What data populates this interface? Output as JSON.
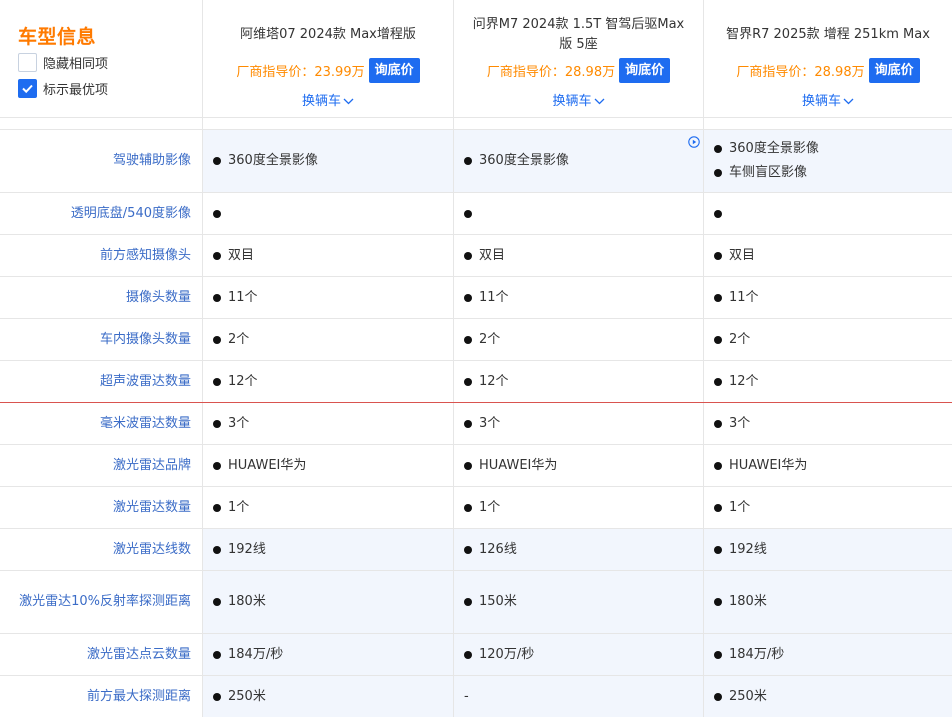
{
  "header": {
    "title": "车型信息",
    "hide_same_label": "隐藏相同项",
    "show_best_label": "标示最优项",
    "hide_same_checked": false,
    "show_best_checked": true,
    "price_prefix": "厂商指导价：",
    "inquiry_label": "询底价",
    "switch_label": "换辆车",
    "cars": [
      {
        "name": "阿维塔07 2024款 Max增程版",
        "price": "23.99万"
      },
      {
        "name": "问界M7 2024款 1.5T 智驾后驱Max版 5座",
        "price": "28.98万"
      },
      {
        "name": "智界R7 2025款 增程 251km Max",
        "price": "28.98万"
      }
    ]
  },
  "colors": {
    "accent_orange": "#ff7a00",
    "brand_blue": "#1e6cf0",
    "label_blue": "#3b6cc7",
    "highlight_bg": "#f2f6fd",
    "divider_red": "#d9534f"
  },
  "rows": [
    {
      "label": "驾驶辅助影像",
      "h": 63,
      "hl": true,
      "values": [
        [
          "360度全景影像"
        ],
        [
          "360度全景影像"
        ],
        [
          "360度全景影像",
          "车侧盲区影像"
        ]
      ]
    },
    {
      "label": "透明底盘/540度影像",
      "h": 42,
      "values": [
        [
          ""
        ],
        [
          ""
        ],
        [
          ""
        ]
      ]
    },
    {
      "label": "前方感知摄像头",
      "h": 42,
      "values": [
        [
          "双目"
        ],
        [
          "双目"
        ],
        [
          "双目"
        ]
      ]
    },
    {
      "label": "摄像头数量",
      "h": 42,
      "values": [
        [
          "11个"
        ],
        [
          "11个"
        ],
        [
          "11个"
        ]
      ]
    },
    {
      "label": "车内摄像头数量",
      "h": 42,
      "values": [
        [
          "2个"
        ],
        [
          "2个"
        ],
        [
          "2个"
        ]
      ]
    },
    {
      "label": "超声波雷达数量",
      "h": 42,
      "red": true,
      "values": [
        [
          "12个"
        ],
        [
          "12个"
        ],
        [
          "12个"
        ]
      ]
    },
    {
      "label": "毫米波雷达数量",
      "h": 42,
      "values": [
        [
          "3个"
        ],
        [
          "3个"
        ],
        [
          "3个"
        ]
      ]
    },
    {
      "label": "激光雷达品牌",
      "h": 42,
      "values": [
        [
          "HUAWEI华为"
        ],
        [
          "HUAWEI华为"
        ],
        [
          "HUAWEI华为"
        ]
      ]
    },
    {
      "label": "激光雷达数量",
      "h": 42,
      "values": [
        [
          "1个"
        ],
        [
          "1个"
        ],
        [
          "1个"
        ]
      ]
    },
    {
      "label": "激光雷达线数",
      "h": 42,
      "hl": true,
      "values": [
        [
          "192线"
        ],
        [
          "126线"
        ],
        [
          "192线"
        ]
      ]
    },
    {
      "label": "激光雷达10%反射率探测距离",
      "h": 63,
      "hl": true,
      "values": [
        [
          "180米"
        ],
        [
          "150米"
        ],
        [
          "180米"
        ]
      ]
    },
    {
      "label": "激光雷达点云数量",
      "h": 42,
      "hl": true,
      "values": [
        [
          "184万/秒"
        ],
        [
          "120万/秒"
        ],
        [
          "184万/秒"
        ]
      ]
    },
    {
      "label": "前方最大探测距离",
      "h": 42,
      "hl": true,
      "values": [
        [
          "250米"
        ],
        [
          "-"
        ],
        [
          "250米"
        ]
      ]
    }
  ]
}
